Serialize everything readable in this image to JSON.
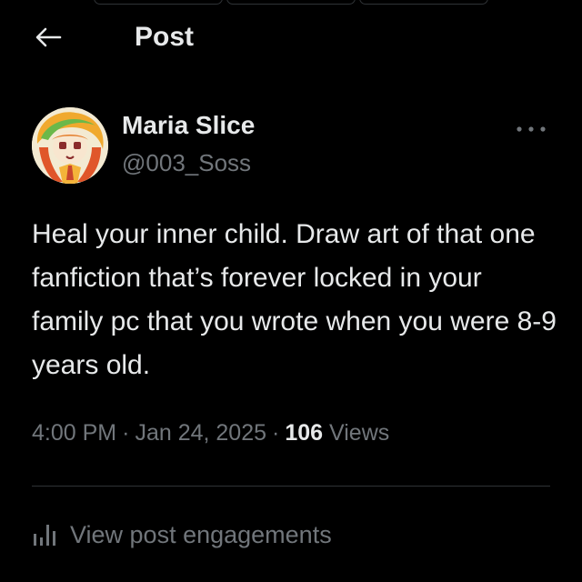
{
  "header": {
    "title": "Post"
  },
  "post": {
    "author": {
      "display_name": "Maria Slice",
      "handle": "@003_Soss"
    },
    "text": "Heal your inner child. Draw art of that one fanfiction that’s forever locked in your family pc that you wrote when you were 8-9 years old.",
    "time": "4:00 PM",
    "date": "Jan 24, 2025",
    "views_count": "106",
    "views_label": "Views",
    "separator": "·"
  },
  "engagements": {
    "label": "View post engagements",
    "icon": "analytics-icon"
  },
  "icons": {
    "back": "back-arrow-icon",
    "more": "more-options-icon"
  },
  "colors": {
    "background": "#000000",
    "primary_text": "#e7e9ea",
    "secondary_text": "#71767b",
    "divider": "#2f3336"
  }
}
